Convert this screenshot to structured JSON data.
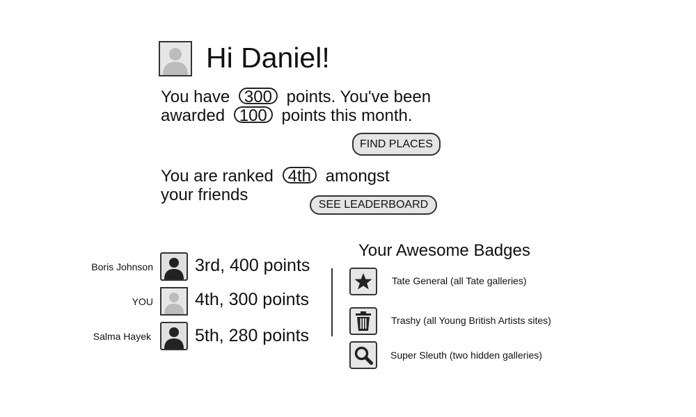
{
  "header": {
    "greeting": "Hi Daniel!"
  },
  "points": {
    "line1_prefix": "You have",
    "total": "300",
    "line1_suffix": "points. You've been",
    "line2_prefix": "awarded",
    "month": "100",
    "line2_suffix": "points this month."
  },
  "find_places_label": "FIND PLACES",
  "rank": {
    "line1_prefix": "You are ranked",
    "value": "4th",
    "line1_suffix": "amongst",
    "line2": "your friends"
  },
  "leaderboard_label": "SEE LEADERBOARD",
  "leaderboard": [
    {
      "name": "Boris Johnson",
      "score": "3rd, 400 points"
    },
    {
      "name": "YOU",
      "score": "4th, 300 points"
    },
    {
      "name": "Salma Hayek",
      "score": "5th, 280 points"
    }
  ],
  "badges": {
    "title": "Your Awesome Badges",
    "items": [
      {
        "icon": "star-icon",
        "label": "Tate General (all Tate galleries)"
      },
      {
        "icon": "trash-icon",
        "label": "Trashy (all Young British Artists sites)"
      },
      {
        "icon": "magnifier-icon",
        "label": "Super Sleuth (two hidden galleries)"
      }
    ]
  }
}
